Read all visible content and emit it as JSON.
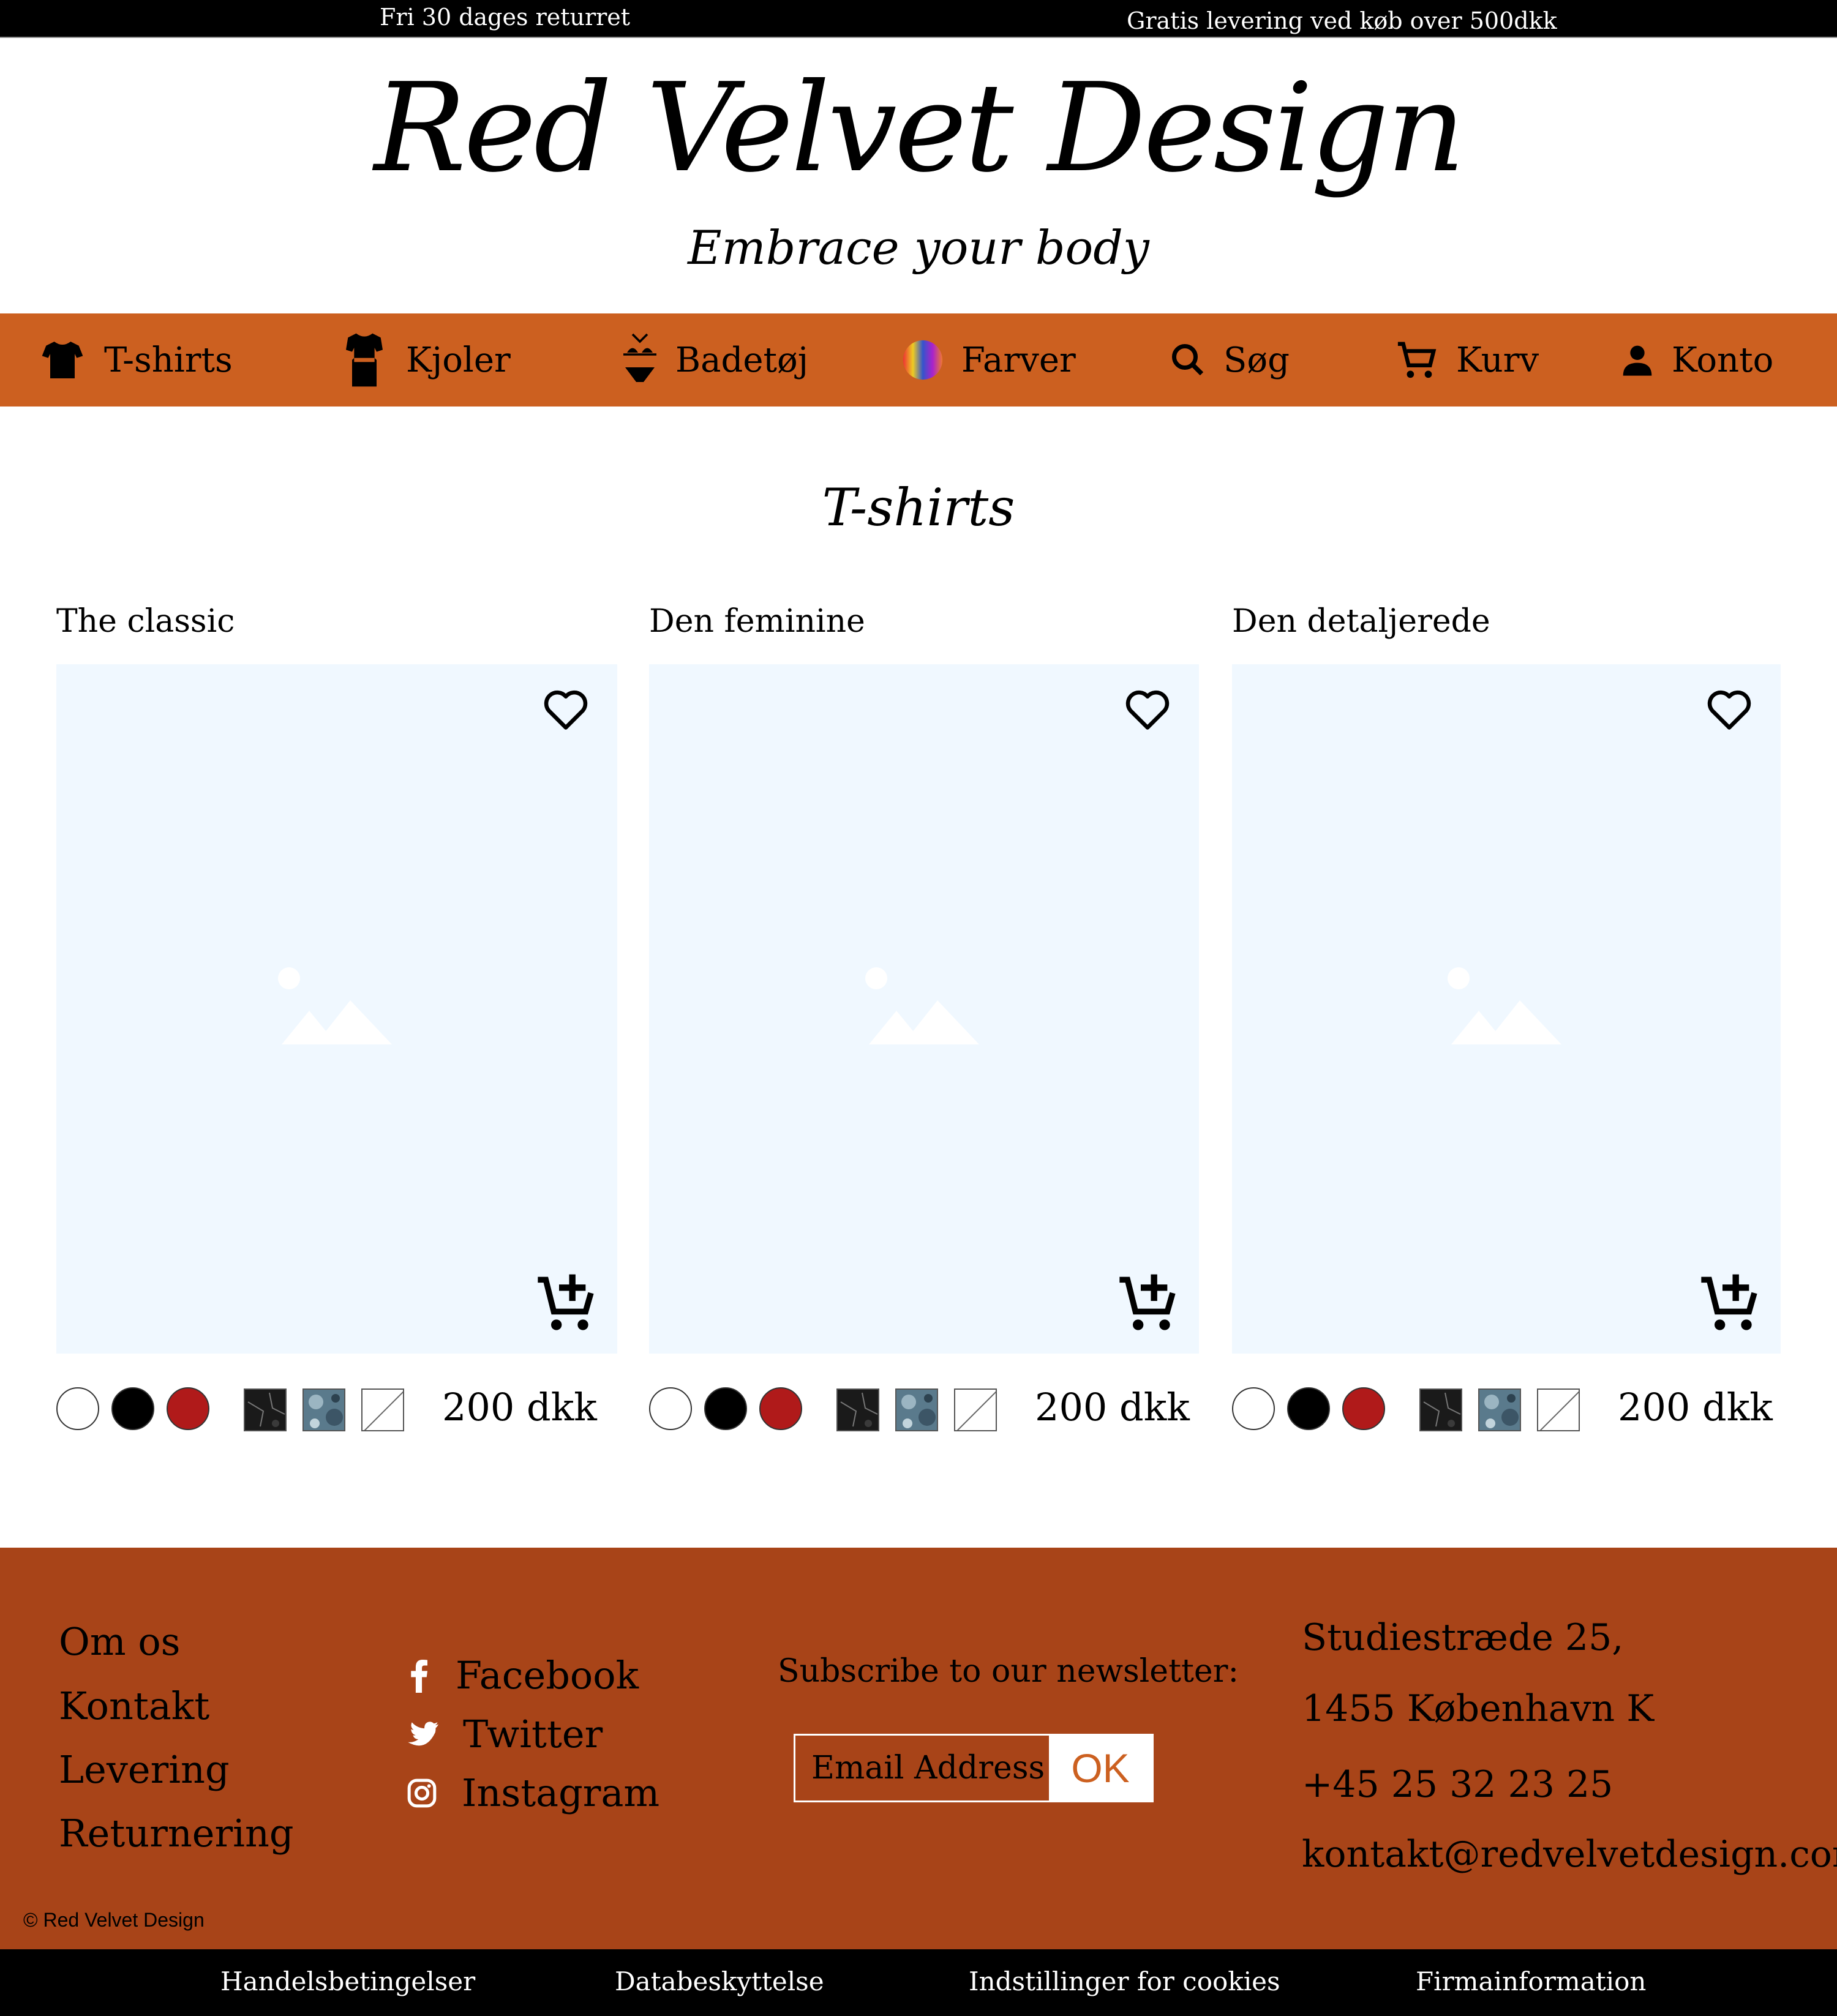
{
  "topbar": {
    "left_text": "Fri 30 dages returret",
    "right_text": "Gratis levering ved køb over 500dkk"
  },
  "header": {
    "brand": "Red Velvet Design",
    "tagline": "Embrace your body"
  },
  "nav": {
    "items": [
      {
        "label": "T-shirts",
        "icon": "tshirt-icon"
      },
      {
        "label": "Kjoler",
        "icon": "dress-icon"
      },
      {
        "label": "Badetøj",
        "icon": "bikini-icon"
      },
      {
        "label": "Farver",
        "icon": "color-wheel-icon"
      },
      {
        "label": "Søg",
        "icon": "search-icon"
      },
      {
        "label": "Kurv",
        "icon": "cart-icon"
      },
      {
        "label": "Konto",
        "icon": "person-icon"
      }
    ]
  },
  "section": {
    "title": "T-shirts"
  },
  "products": [
    {
      "name": "The classic",
      "price": "200 dkk"
    },
    {
      "name": "Den feminine",
      "price": "200 dkk"
    },
    {
      "name": "Den detaljerede",
      "price": "200 dkk"
    }
  ],
  "swatches": {
    "colors": [
      "#ffffff",
      "#000000",
      "#b01a1a"
    ],
    "patterns": [
      "dark-marble",
      "blue-floral",
      "none"
    ]
  },
  "footer": {
    "links": [
      "Om os",
      "Kontakt",
      "Levering",
      "Returnering"
    ],
    "social": [
      {
        "label": "Facebook",
        "icon": "facebook-icon"
      },
      {
        "label": "Twitter",
        "icon": "twitter-icon"
      },
      {
        "label": "Instagram",
        "icon": "instagram-icon"
      }
    ],
    "newsletter": {
      "title": "Subscribe to our newsletter:",
      "placeholder": "Email Address",
      "button": "OK"
    },
    "address": {
      "street": "Studiestræde 25,",
      "city": "1455 København K",
      "phone": "+45 25 32 23 25",
      "email": "kontakt@redvelvetdesign.com"
    },
    "copyright": "© Red Velvet Design"
  },
  "bottombar": {
    "links": [
      "Handelsbetingelser",
      "Databeskyttelse",
      "Indstillinger for cookies",
      "Firmainformation"
    ]
  },
  "colors": {
    "nav_bg": "#cc6020",
    "footer_bg": "#a84418",
    "image_placeholder_bg": "#f0f8ff",
    "bar_bg": "#000000"
  }
}
